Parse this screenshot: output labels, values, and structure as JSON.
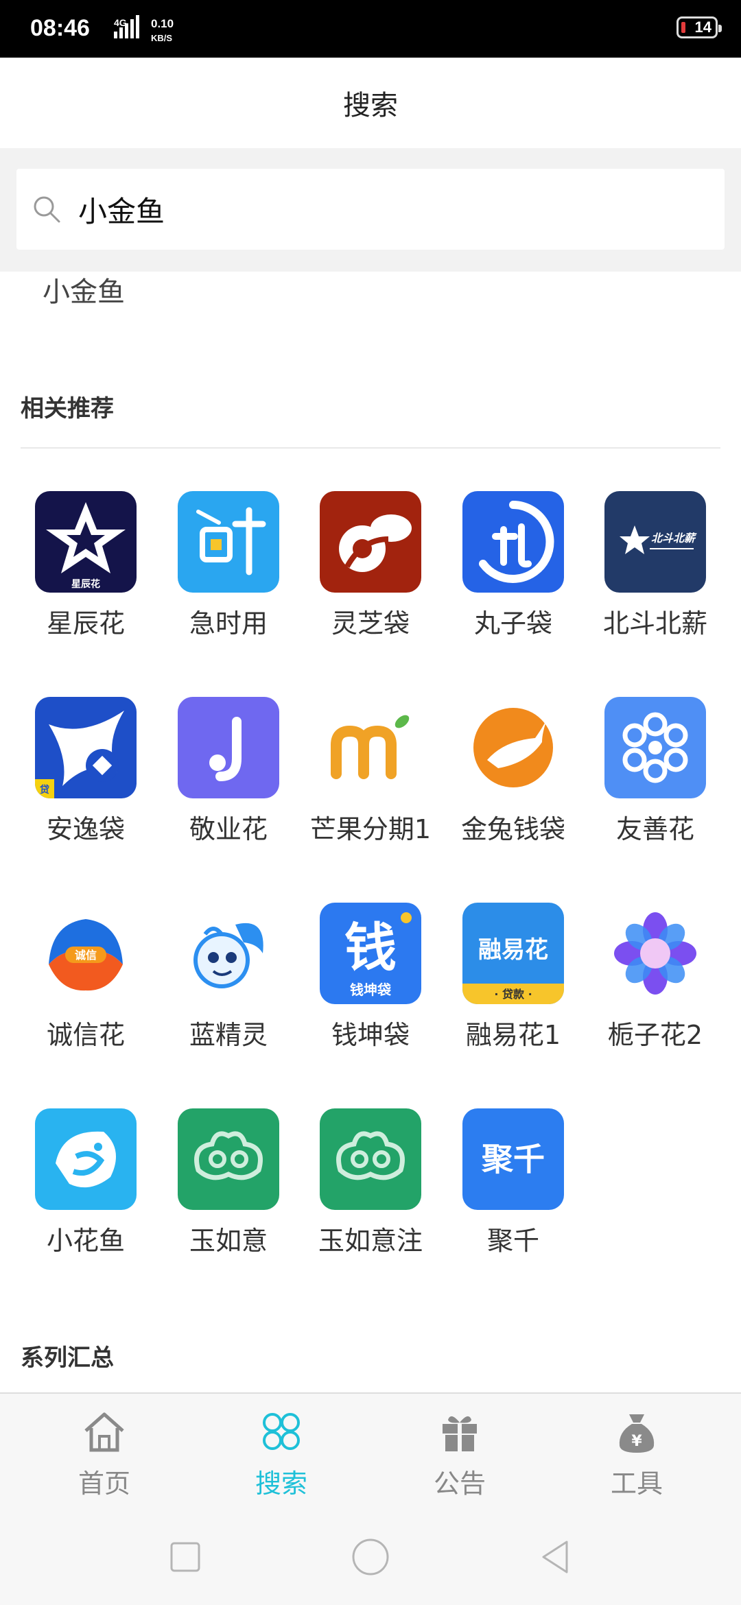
{
  "status_bar": {
    "time": "08:46",
    "network_type": "4G",
    "speed_value": "0.10",
    "speed_unit": "KB/S",
    "battery": "14"
  },
  "header": {
    "title": "搜索"
  },
  "search": {
    "query": "小金鱼",
    "placeholder": ""
  },
  "suggestions": [
    "小金鱼"
  ],
  "recommended": {
    "title": "相关推荐",
    "apps": [
      {
        "name": "星辰花",
        "icon": "star-logo-icon",
        "color": "#14144a"
      },
      {
        "name": "急时用",
        "icon": "time-logo-icon",
        "color": "#2aa6f0"
      },
      {
        "name": "灵芝袋",
        "icon": "lingzhi-logo-icon",
        "color": "#a2230e"
      },
      {
        "name": "丸子袋",
        "icon": "wanzi-logo-icon",
        "color": "#2563e6"
      },
      {
        "name": "北斗北薪",
        "icon": "beidou-logo-icon",
        "color": "#223a68"
      },
      {
        "name": "安逸袋",
        "icon": "kangaroo-logo-icon",
        "color": "#1e4fc8"
      },
      {
        "name": "敬业花",
        "icon": "j-logo-icon",
        "color": "#6f68f0"
      },
      {
        "name": "芒果分期1",
        "icon": "mango-logo-icon",
        "color": "#ffffff"
      },
      {
        "name": "金兔钱袋",
        "icon": "rabbit-logo-icon",
        "color": "#ffffff"
      },
      {
        "name": "友善花",
        "icon": "flower-ring-logo-icon",
        "color": "#4f8ff5"
      },
      {
        "name": "诚信花",
        "icon": "chengxin-logo-icon",
        "color": "#ffffff"
      },
      {
        "name": "蓝精灵",
        "icon": "smurf-logo-icon",
        "color": "#ffffff"
      },
      {
        "name": "钱坤袋",
        "icon": "qian-logo-icon",
        "color": "#2c79f0"
      },
      {
        "name": "融易花1",
        "icon": "rongyihua-logo-icon",
        "color": "#2c8de8"
      },
      {
        "name": "栀子花2",
        "icon": "gardenia-logo-icon",
        "color": "#ffffff"
      },
      {
        "name": "小花鱼",
        "icon": "fish-logo-icon",
        "color": "#29b3f0"
      },
      {
        "name": "玉如意",
        "icon": "ruyi-logo-icon",
        "color": "#23a368"
      },
      {
        "name": "玉如意注",
        "icon": "ruyi-logo-icon",
        "color": "#23a368"
      },
      {
        "name": "聚千",
        "icon": "juqian-logo-icon",
        "color": "#2c7df0"
      }
    ],
    "icon_text": {
      "xingchen": "星辰花",
      "beidou": "北斗北薪",
      "qian_big": "钱",
      "qian_small": "钱坤袋",
      "rongyi": "融易花",
      "rongyi_sub": "· 贷款 ·",
      "juqian": "聚千",
      "chengxin": "诚信",
      "anyi": "贷"
    }
  },
  "series": {
    "title": "系列汇总"
  },
  "bottom_nav": [
    {
      "label": "首页",
      "icon": "home-icon",
      "active": false
    },
    {
      "label": "搜索",
      "icon": "clover-icon",
      "active": true
    },
    {
      "label": "公告",
      "icon": "gift-icon",
      "active": false
    },
    {
      "label": "工具",
      "icon": "money-bag-icon",
      "active": false
    }
  ],
  "colors": {
    "accent": "#1ec0d8",
    "inactive": "#888888"
  }
}
